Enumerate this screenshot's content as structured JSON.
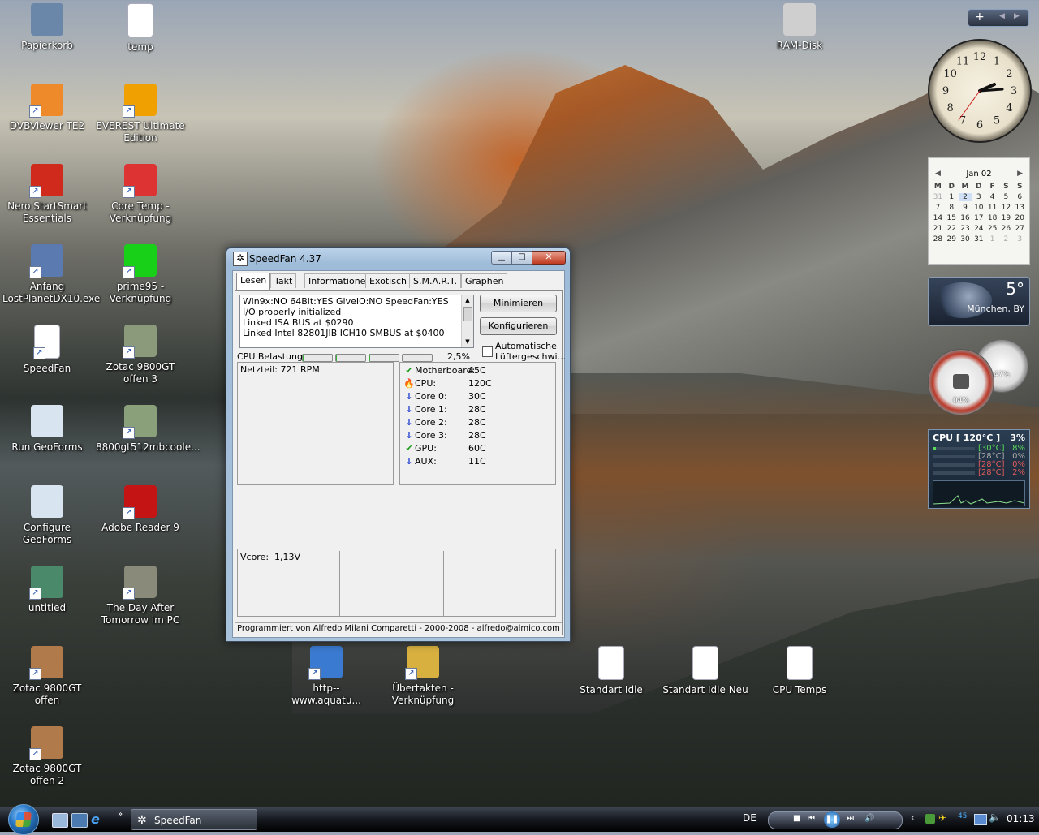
{
  "desktop": {
    "icons": [
      {
        "label": "Papierkorb",
        "color": "#6a86a8"
      },
      {
        "label": "temp",
        "color": "#ffffff"
      },
      {
        "label": "DVBViewer TE2",
        "color": "#ee8a2a"
      },
      {
        "label": "EVEREST Ultimate Edition",
        "color": "#f0a000"
      },
      {
        "label": "Nero StartSmart Essentials",
        "color": "#d02a1c"
      },
      {
        "label": "Core Temp - Verknüpfung",
        "color": "#d33"
      },
      {
        "label": "Anfang LostPlanetDX10.exe",
        "color": "#5a7ab0"
      },
      {
        "label": "prime95 - Verknüpfung",
        "color": "#19d019"
      },
      {
        "label": "SpeedFan",
        "color": "#ffffff"
      },
      {
        "label": "Zotac 9800GT offen 3",
        "color": "#8a9a7a"
      },
      {
        "label": "Run GeoForms",
        "color": "#d8e4ef"
      },
      {
        "label": "8800gt512mbcoole...",
        "color": "#8aa07a"
      },
      {
        "label": "Configure GeoForms",
        "color": "#d8e4ef"
      },
      {
        "label": "Adobe Reader 9",
        "color": "#c41414"
      },
      {
        "label": "untitled",
        "color": "#4a8a6a"
      },
      {
        "label": "The Day After Tomorrow im PC",
        "color": "#8a8a7a"
      },
      {
        "label": "Zotac 9800GT offen",
        "color": "#b07a4a"
      },
      {
        "label": "Zotac 9800GT offen 2",
        "color": "#b07a4a"
      },
      {
        "label": "http--www.aquatu...",
        "color": "#3a7ad0"
      },
      {
        "label": "Übertakten - Verknüpfung",
        "color": "#d8b040"
      },
      {
        "label": "Standart Idle",
        "color": "#ffffff"
      },
      {
        "label": "Standart Idle Neu",
        "color": "#ffffff"
      },
      {
        "label": "CPU Temps",
        "color": "#ffffff"
      },
      {
        "label": "RAM-Disk",
        "color": "#cfcfcf"
      }
    ]
  },
  "speedfan": {
    "title": "SpeedFan 4.37",
    "tabs": [
      "Lesen",
      "Takt",
      "Informationen",
      "Exotisch",
      "S.M.A.R.T.",
      "Graphen"
    ],
    "log_lines": [
      "Win9x:NO  64Bit:YES  GiveIO:NO  SpeedFan:YES",
      "I/O properly initialized",
      "Linked ISA BUS at $0290",
      "Linked Intel 82801JIB ICH10 SMBUS at $0400"
    ],
    "buttons": {
      "minimize": "Minimieren",
      "configure": "Konfigurieren"
    },
    "auto_fan_label": "Automatische Lüftergeschwi...",
    "cpu_usage_label": "CPU Belastung",
    "cpu_usage_value": "2,5%",
    "cpu_usage_fraction": 0.025,
    "fans": [
      "Netzteil: 721 RPM"
    ],
    "temps": [
      {
        "name": "Motherboard:",
        "value": "45C",
        "icon": "check-icon"
      },
      {
        "name": "CPU:",
        "value": "120C",
        "icon": "flame-icon"
      },
      {
        "name": "Core 0:",
        "value": "30C",
        "icon": "down-arrow-icon"
      },
      {
        "name": "Core 1:",
        "value": "28C",
        "icon": "down-arrow-icon"
      },
      {
        "name": "Core 2:",
        "value": "28C",
        "icon": "down-arrow-icon"
      },
      {
        "name": "Core 3:",
        "value": "28C",
        "icon": "down-arrow-icon"
      },
      {
        "name": "GPU:",
        "value": "60C",
        "icon": "check-icon"
      },
      {
        "name": "AUX:",
        "value": "11C",
        "icon": "down-arrow-icon"
      }
    ],
    "voltages": {
      "vcore_label": "Vcore:",
      "vcore_value": "1,13V"
    },
    "footer": "Programmiert von Alfredo Milani Comparetti - 2000-2008 - alfredo@almico.com"
  },
  "gadgets": {
    "calendar": {
      "month": "Jan 02",
      "weekdays": [
        "M",
        "D",
        "M",
        "D",
        "F",
        "S",
        "S"
      ],
      "rows": [
        [
          "31",
          "1",
          "2",
          "3",
          "4",
          "5",
          "6"
        ],
        [
          "7",
          "8",
          "9",
          "10",
          "11",
          "12",
          "13"
        ],
        [
          "14",
          "15",
          "16",
          "17",
          "18",
          "19",
          "20"
        ],
        [
          "21",
          "22",
          "23",
          "24",
          "25",
          "26",
          "27"
        ],
        [
          "28",
          "29",
          "30",
          "31",
          "1",
          "2",
          "3"
        ]
      ]
    },
    "weather": {
      "temp": "5°",
      "city": "München, BY"
    },
    "meters": {
      "cpu_percent": "04%",
      "mem_percent": "47%"
    },
    "cpu_monitor": {
      "title": "CPU [ 120°C ]",
      "total": "3%",
      "cores": [
        {
          "temp": "[30°C]",
          "load": "8%",
          "color": "#5ad85a"
        },
        {
          "temp": "[28°C]",
          "load": "0%",
          "color": "#a8a8a8"
        },
        {
          "temp": "[28°C]",
          "load": "0%",
          "color": "#e05a5a"
        },
        {
          "temp": "[28°C]",
          "load": "2%",
          "color": "#e05a5a"
        }
      ]
    },
    "clock_numbers": [
      "12",
      "1",
      "2",
      "3",
      "4",
      "5",
      "6",
      "7",
      "8",
      "9",
      "10",
      "11"
    ]
  },
  "taskbar": {
    "task_label": "SpeedFan",
    "language": "DE",
    "time": "01:13"
  }
}
